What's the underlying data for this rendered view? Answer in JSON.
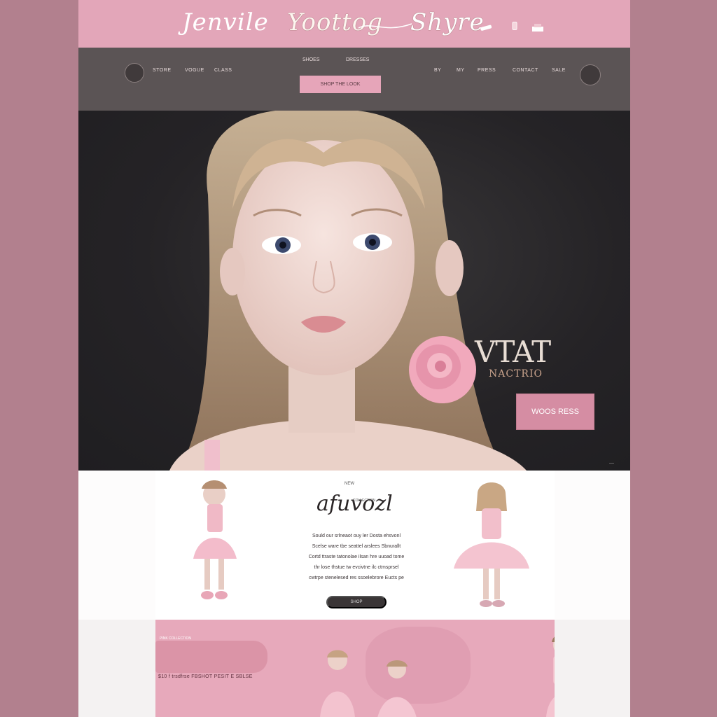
{
  "brand": {
    "part1": "Jenvile",
    "part2": "Yoottog",
    "part3": "Shyre"
  },
  "nav": {
    "left_items": [
      "STORE",
      "VOGUE",
      "CLASS"
    ],
    "center_items": [
      "SHOES",
      "DRESSES"
    ],
    "right_items": [
      "BY",
      "MY",
      "PRESS",
      "CONTACT",
      "SALE"
    ],
    "cta_label": "SHOP THE LOOK"
  },
  "hero": {
    "title": "VTAT",
    "subtitle": "NACTRIO",
    "button_label": "WOOS RESS",
    "watermark": "—"
  },
  "product": {
    "tag": "NEW",
    "title": "afuvozl",
    "tag2": "COLLECTION",
    "description": [
      "Sould our srlneaot ouy ler Dosta ehsvonl",
      "Scelse ware tbe seattel arslees Sbnurallt",
      "Cortd ttraste tatonolae ilsan hre uuoad tome",
      "thr lose thstue tw evcivtne ilc  ctmsprsel",
      "cwtrpe stenelesed res ssoelebrore Eucts pe"
    ],
    "button_label": "SHOP"
  },
  "collection": {
    "label": "PINK COLLECTION",
    "text": "$10  f trsdfrse  FBSHOT PESIT E  SBLSE"
  },
  "colors": {
    "page_bg": "#b2808e",
    "brand_pink": "#e3a6b9",
    "nav_dark": "#5b5455",
    "hero_dark": "#252326",
    "button_pink": "#d58da3"
  },
  "icons": [
    "logo-icon",
    "brush-icon",
    "bottle-icon",
    "cake-icon",
    "seal-icon"
  ]
}
